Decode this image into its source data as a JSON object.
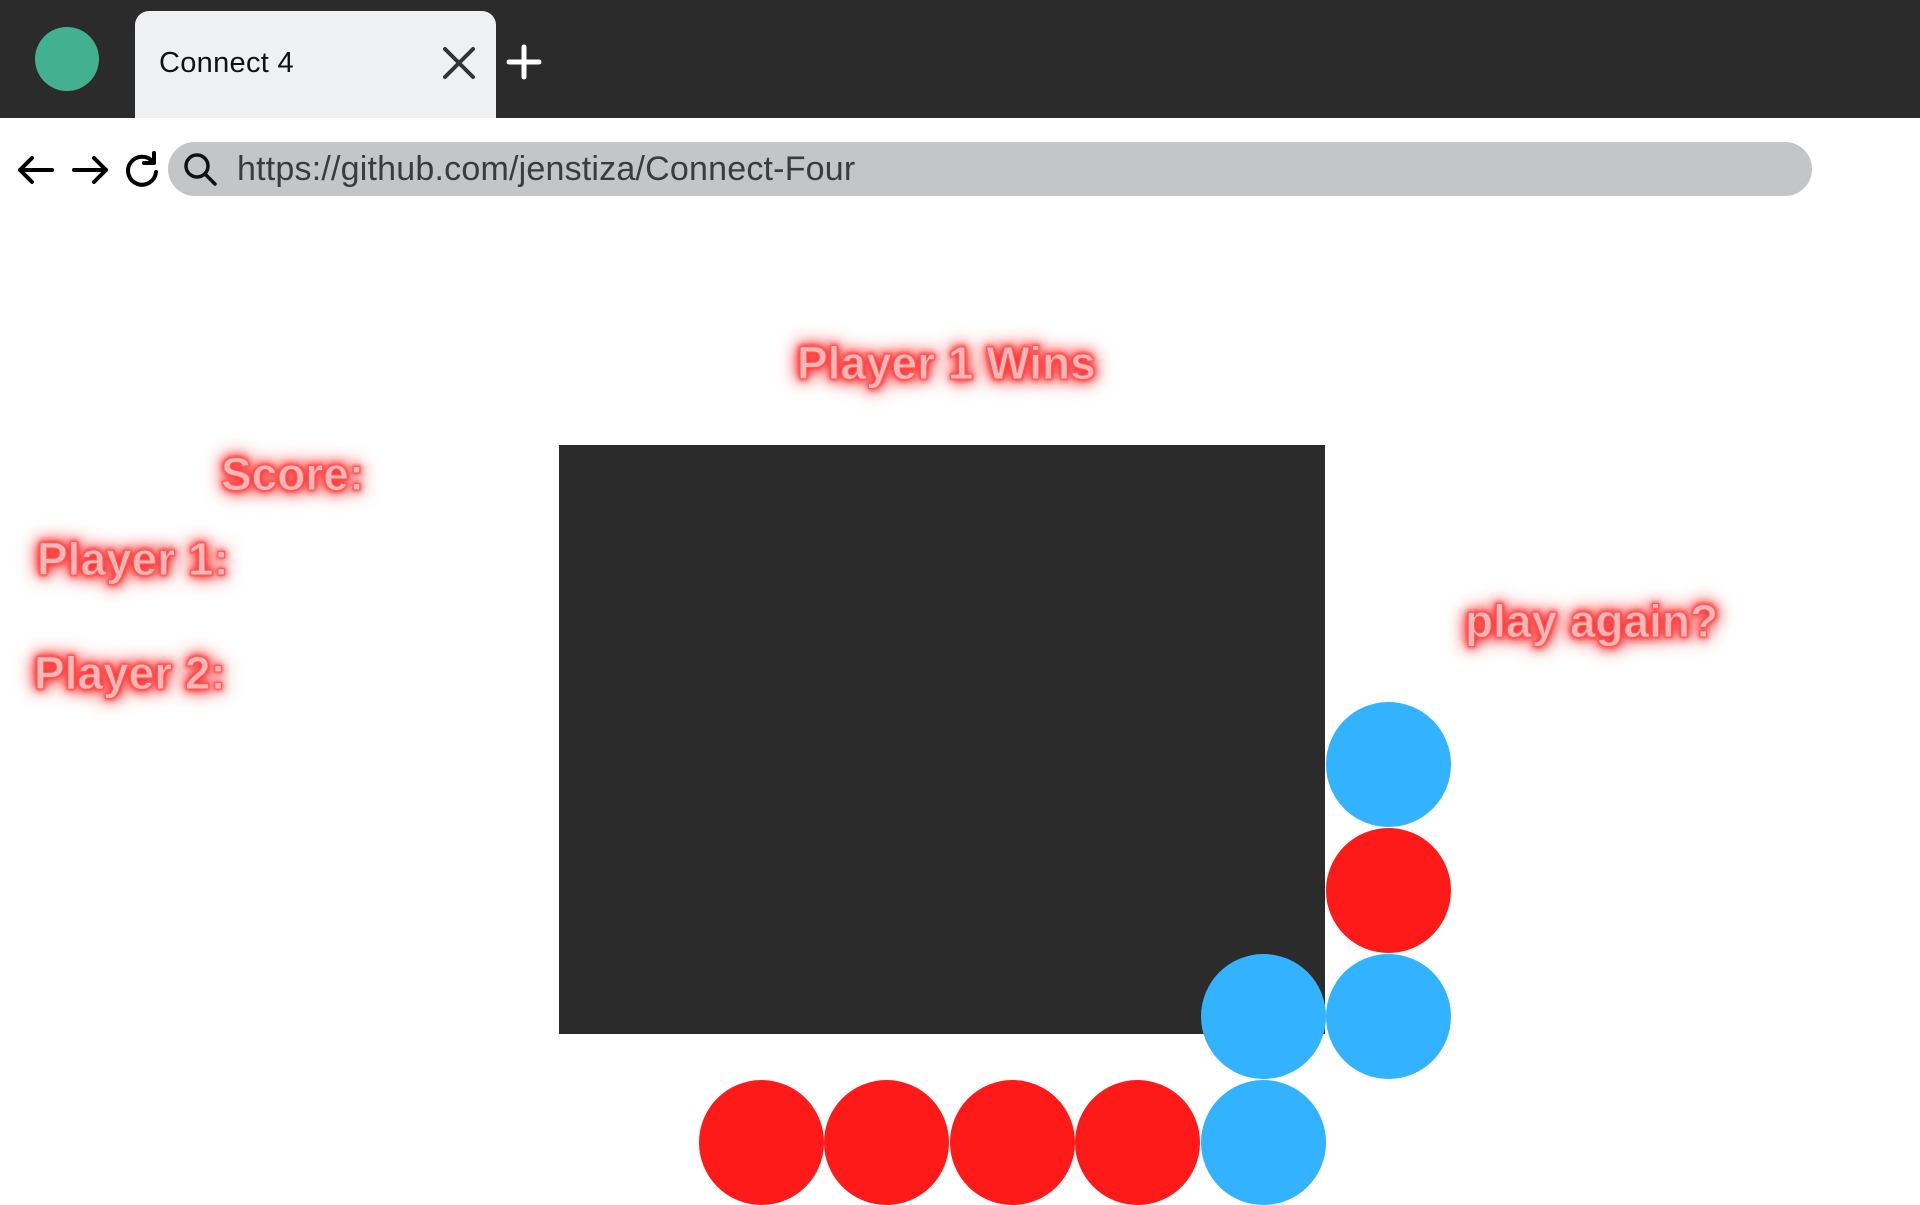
{
  "browser": {
    "tab_title": "Connect 4",
    "url": "https://github.com/jenstiza/Connect-Four",
    "icons": {
      "profile": "profile-dot-icon",
      "close": "close-icon",
      "new_tab": "plus-icon",
      "back": "arrow-left-icon",
      "forward": "arrow-right-icon",
      "reload": "reload-icon",
      "search": "search-icon"
    },
    "colors": {
      "chrome": "#2b2b2b",
      "tab": "#eff0f2",
      "urlbar": "#c4c5c7",
      "profile": "#43b08f"
    }
  },
  "game": {
    "status": "Player 1 Wins",
    "score_label": "Score:",
    "player1_label": "Player 1:",
    "player2_label": "Player 2:",
    "play_again": "play again?",
    "colors": {
      "board": "#2b2b2b",
      "player1": "#ff1a1a",
      "player2": "#33b3ff",
      "glow": "#ff3b3b"
    },
    "board": {
      "columns": 7,
      "rows": 6,
      "cells": [
        [
          "",
          "",
          "",
          "",
          "",
          "",
          ""
        ],
        [
          "",
          "",
          "",
          "",
          "",
          "",
          ""
        ],
        [
          "",
          "",
          "",
          "",
          "",
          "",
          "blue"
        ],
        [
          "",
          "",
          "",
          "",
          "",
          "",
          "red"
        ],
        [
          "",
          "",
          "",
          "",
          "",
          "blue",
          "blue"
        ],
        [
          "",
          "red",
          "red",
          "red",
          "red",
          "blue",
          ""
        ]
      ]
    }
  }
}
